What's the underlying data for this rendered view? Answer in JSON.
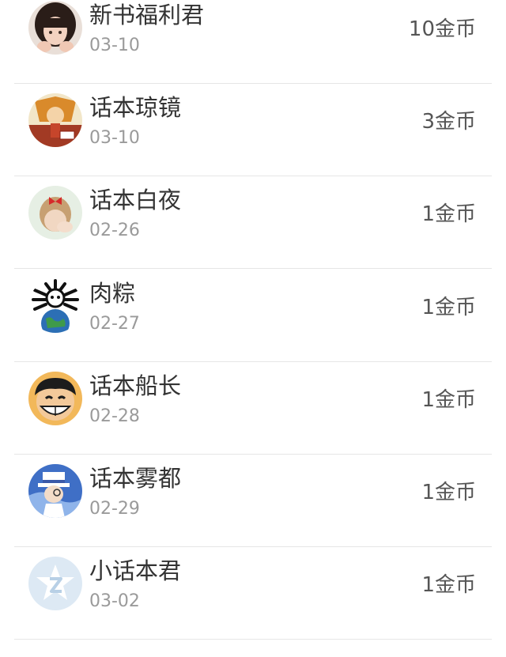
{
  "records": [
    {
      "name": "新书福利君",
      "date": "03-10",
      "reward": "10金币",
      "avatar": "girl-avatar"
    },
    {
      "name": "话本琼镜",
      "date": "03-10",
      "reward": "3金币",
      "avatar": "anime-artwork-avatar"
    },
    {
      "name": "话本白夜",
      "date": "02-26",
      "reward": "1金币",
      "avatar": "girl-bow-avatar"
    },
    {
      "name": "肉粽",
      "date": "02-27",
      "reward": "1金币",
      "avatar": "cartoon-earth-avatar"
    },
    {
      "name": "话本船长",
      "date": "02-28",
      "reward": "1金币",
      "avatar": "luffy-avatar"
    },
    {
      "name": "话本雾都",
      "date": "02-29",
      "reward": "1金币",
      "avatar": "kid-thief-avatar"
    },
    {
      "name": "小话本君",
      "date": "03-02",
      "reward": "1金币",
      "avatar": "app-logo-avatar"
    }
  ],
  "colors": {
    "name_text": "#333333",
    "date_text": "#9a9a9a",
    "reward_text": "#555555",
    "divider": "#e6e6e6"
  }
}
